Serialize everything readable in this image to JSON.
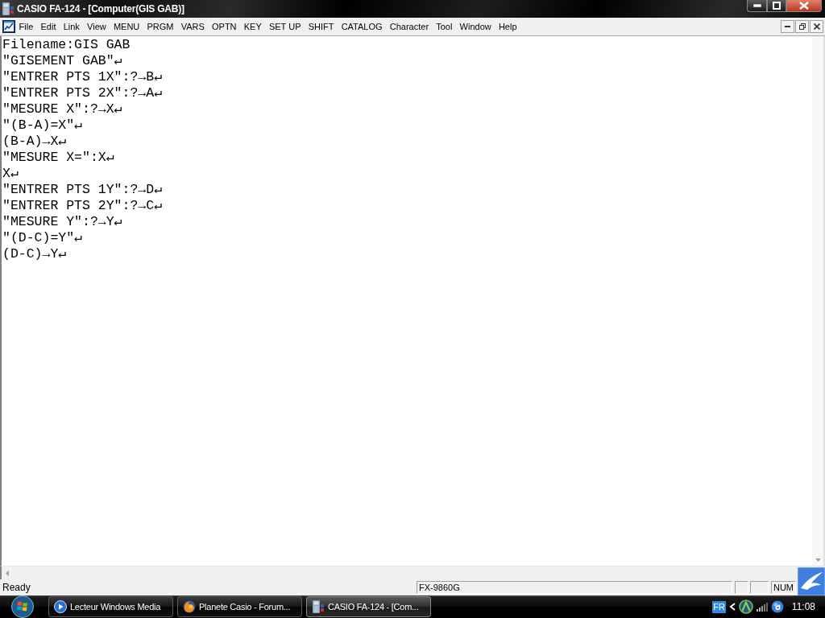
{
  "window": {
    "title": "CASIO FA-124 - [Computer(GIS GAB)]"
  },
  "menu_bar": {
    "items": [
      "File",
      "Edit",
      "Link",
      "View",
      "MENU",
      "PRGM",
      "VARS",
      "OPTN",
      "KEY",
      "SET UP",
      "SHIFT",
      "CATALOG",
      "Character",
      "Tool",
      "Window",
      "Help"
    ]
  },
  "editor": {
    "filename": "Filename:GIS GAB",
    "lines": [
      "\"GISEMENT GAB\"↵",
      "\"ENTRER PTS 1X\":?→B↵",
      "\"ENTRER PTS 2X\":?→A↵",
      "\"MESURE X\":?→X↵",
      "\"(B-A)=X\"↵",
      "(B-A)→X↵",
      "\"MESURE X=\":X↵",
      "X↵",
      "\"ENTRER PTS 1Y\":?→D↵",
      "\"ENTRER PTS 2Y\":?→C↵",
      "\"MESURE Y\":?→Y↵",
      "\"(D-C)=Y\"↵",
      "(D-C)→Y↵"
    ]
  },
  "status_bar": {
    "message": "Ready",
    "model": "FX-9860G",
    "num_lock": "NUM"
  },
  "taskbar": {
    "buttons": [
      {
        "kind": "player",
        "label": "Lecteur Windows Media",
        "selected": false
      },
      {
        "kind": "browser",
        "label": "Planete Casio - Forum...",
        "selected": false
      },
      {
        "kind": "calculator",
        "label": "CASIO FA-124 - [Com...",
        "selected": true
      }
    ],
    "language": "FR",
    "clock": "11:08"
  }
}
